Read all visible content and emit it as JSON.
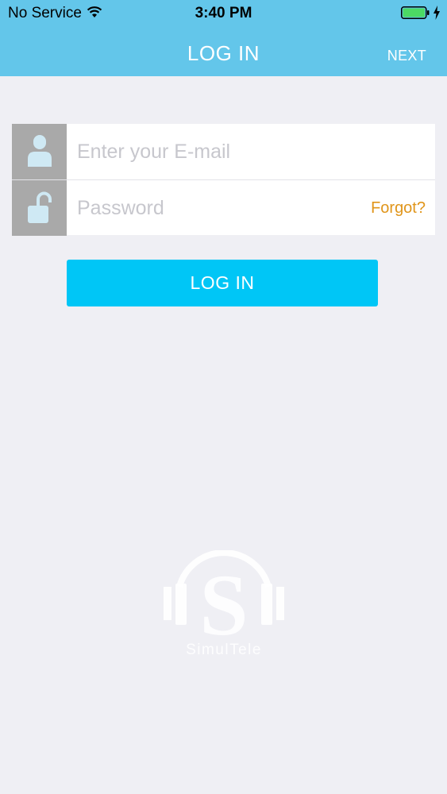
{
  "status_bar": {
    "carrier": "No Service",
    "time": "3:40 PM"
  },
  "nav": {
    "title": "LOG IN",
    "next_label": "NEXT"
  },
  "form": {
    "email_placeholder": "Enter your E-mail",
    "password_placeholder": "Password",
    "forgot_label": "Forgot?"
  },
  "login_button_label": "LOG IN",
  "logo": {
    "letter": "S",
    "name": "SimulTele"
  },
  "colors": {
    "header": "#63c6ea",
    "button": "#00c6f6",
    "forgot": "#e0951a",
    "icon_box": "#a9a9a9",
    "background": "#efeff4"
  },
  "icons": {
    "email_row": "user-icon",
    "password_row": "unlock-icon",
    "status": [
      "wifi-icon",
      "battery-icon",
      "charging-icon"
    ]
  }
}
